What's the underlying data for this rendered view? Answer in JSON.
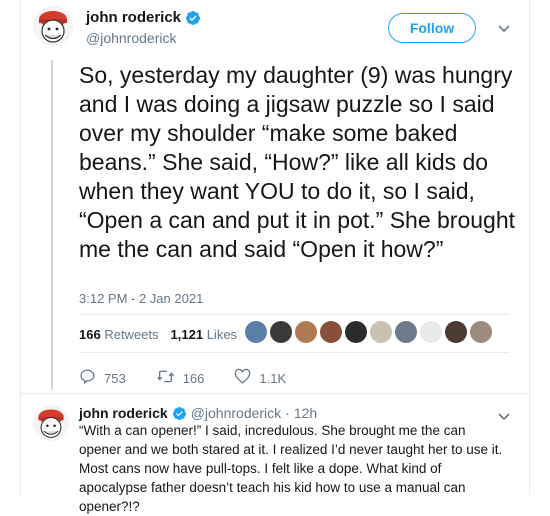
{
  "tweet": {
    "author_name": "john roderick",
    "author_handle": "@johnroderick",
    "follow_label": "Follow",
    "text": "So, yesterday my daughter (9) was hungry and I was doing a jigsaw puzzle so I said over my shoulder “make some baked beans.” She said, “How?” like all kids do when they want YOU to do it, so I said, “Open a can and put it in pot.” She brought me the can and said “Open it how?”",
    "timestamp": "3:12 PM - 2 Jan 2021",
    "retweets_count": "166",
    "retweets_label": "Retweets",
    "likes_count": "1,121",
    "likes_label": "Likes",
    "actions": {
      "replies": "753",
      "retweets": "166",
      "likes": "1.1K"
    }
  },
  "likers": [
    {
      "color": "#5b7fa8",
      "name": "liker-avatar"
    },
    {
      "color": "#3a3a3a",
      "name": "liker-avatar"
    },
    {
      "color": "#b07a55",
      "name": "liker-avatar"
    },
    {
      "color": "#8a4f3c",
      "name": "liker-avatar"
    },
    {
      "color": "#2c2c2c",
      "name": "liker-avatar"
    },
    {
      "color": "#c9c2b0",
      "name": "liker-avatar"
    },
    {
      "color": "#6e7b8c",
      "name": "liker-avatar"
    },
    {
      "color": "#e8e8e8",
      "name": "liker-avatar"
    },
    {
      "color": "#4a3a30",
      "name": "liker-avatar"
    },
    {
      "color": "#9a8b7a",
      "name": "liker-avatar"
    }
  ],
  "reply": {
    "author_name": "john roderick",
    "author_handle": "@johnroderick",
    "time": "12h",
    "separator": "·",
    "text": "“With a can opener!” I said, incredulous. She brought me the can opener and we both stared at it. I realized I’d never taught her to use it. Most cans now have pull-tops. I felt like a dope. What kind of apocalypse father doesn’t teach his kid how to use a manual can opener?!?"
  },
  "colors": {
    "accent": "#1da1f2",
    "muted": "#657786",
    "text": "#14171a",
    "divider": "#e6ecf0",
    "verified": "#1da1f2",
    "hat": "#d43c2c"
  },
  "icons": [
    "verified-badge-icon",
    "chevron-down-icon",
    "reply-icon",
    "retweet-icon",
    "like-icon"
  ]
}
